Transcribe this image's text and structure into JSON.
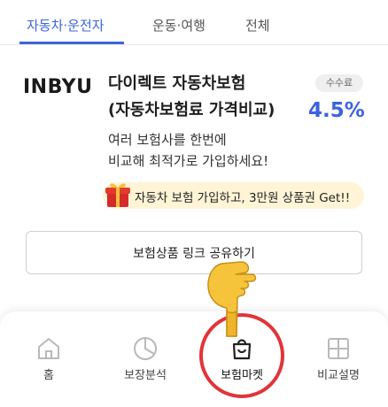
{
  "tabs": {
    "items": [
      {
        "label": "자동차·운전자",
        "active": true
      },
      {
        "label": "운동·여행",
        "active": false
      },
      {
        "label": "전체",
        "active": false
      }
    ],
    "accent_color": "#3d63dd"
  },
  "product": {
    "brand": "INBYU",
    "title_line1": "다이렉트 자동차보험",
    "title_line2": "(자동차보험료 가격비교)",
    "fee_label": "수수료",
    "fee_rate": "4.5%",
    "desc_line1": "여러 보험사를 한번에",
    "desc_line2": "비교해 최적가로 가입하세요!",
    "promo_text": "자동차 보험 가입하고, 3만원 상품권 Get!!",
    "promo_icon": "gift-icon"
  },
  "share_button": {
    "label": "보험상품 링크 공유하기"
  },
  "bottom_nav": {
    "items": [
      {
        "label": "홈",
        "icon": "home-icon",
        "active": false
      },
      {
        "label": "보장분석",
        "icon": "pie-chart-icon",
        "active": false
      },
      {
        "label": "보험마켓",
        "icon": "shopping-bag-icon",
        "active": true
      },
      {
        "label": "비교설명",
        "icon": "grid-icon",
        "active": false
      }
    ],
    "highlight_color": "#e2343a"
  },
  "overlay": {
    "icon": "pointing-hand-icon"
  }
}
